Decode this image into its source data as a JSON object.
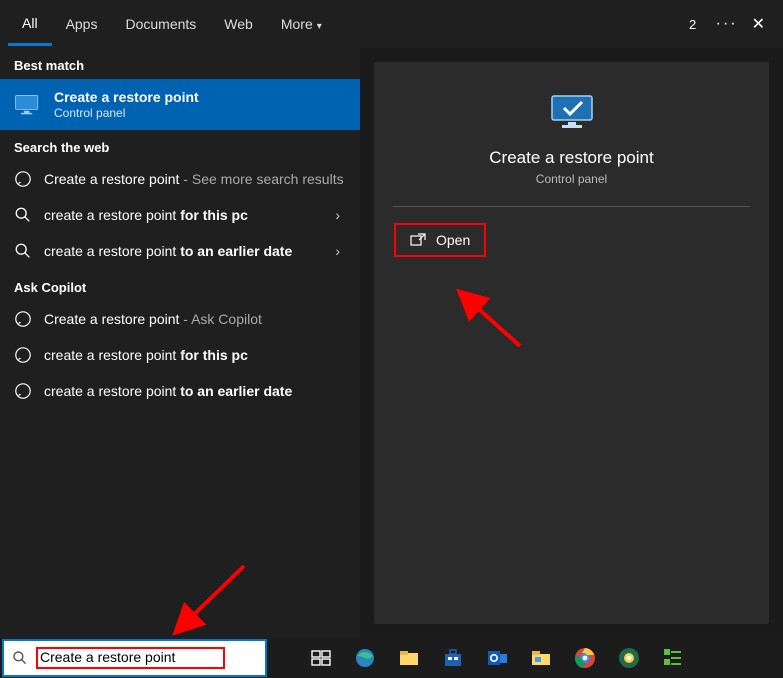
{
  "tabs": {
    "all": "All",
    "apps": "Apps",
    "documents": "Documents",
    "web": "Web",
    "more": "More"
  },
  "header": {
    "count": "2"
  },
  "sections": {
    "best_match": "Best match",
    "search_web": "Search the web",
    "ask_copilot": "Ask Copilot"
  },
  "best_match": {
    "title": "Create a restore point",
    "subtitle": "Control panel"
  },
  "web": {
    "r1": {
      "text": "Create a restore point",
      "suffix": "See more search results"
    },
    "r2": {
      "prefix": "create a restore point ",
      "bold": "for this pc"
    },
    "r3": {
      "prefix": "create a restore point ",
      "bold": "to an earlier date"
    }
  },
  "copilot": {
    "r1": {
      "text": "Create a restore point",
      "suffix": "Ask Copilot"
    },
    "r2": {
      "prefix": "create a restore point ",
      "bold": "for this pc"
    },
    "r3": {
      "prefix": "create a restore point ",
      "bold": "to an earlier date"
    }
  },
  "preview": {
    "title": "Create a restore point",
    "subtitle": "Control panel",
    "open": "Open"
  },
  "search": {
    "value": "Create a restore point"
  }
}
